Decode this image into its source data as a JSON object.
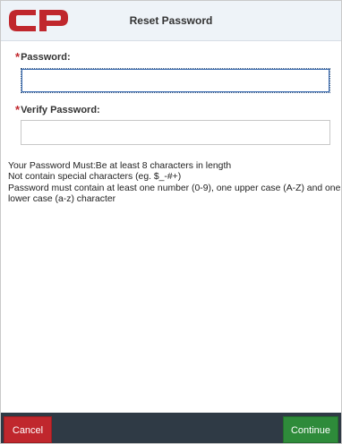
{
  "header": {
    "logo_text": "CP",
    "title": "Reset Password"
  },
  "form": {
    "password": {
      "required_mark": "*",
      "label": "Password:",
      "value": ""
    },
    "verify_password": {
      "required_mark": "*",
      "label": "Verify Password:",
      "value": ""
    }
  },
  "rules": {
    "line1": "Your Password Must:Be at least 8 characters in length",
    "line2": "Not contain special characters (eg. $_-#+)",
    "line3": "Password must contain at least one number (0-9), one upper case (A-Z) and one lower case (a-z) character"
  },
  "footer": {
    "cancel_label": "Cancel",
    "continue_label": "Continue"
  },
  "colors": {
    "brand_red": "#c0272d",
    "continue_green": "#2e8b3a",
    "footer_bg": "#2f3a45"
  }
}
